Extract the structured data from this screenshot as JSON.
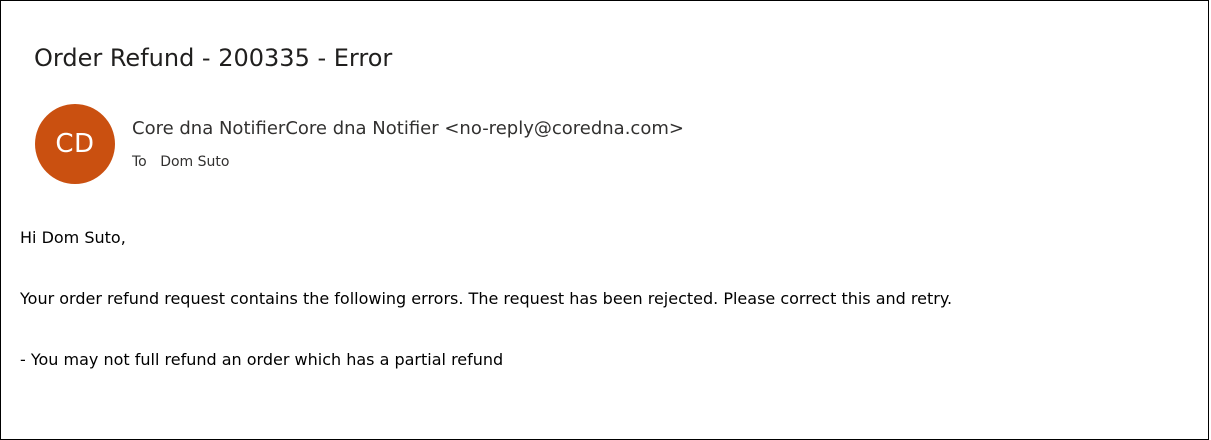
{
  "email": {
    "subject": "Order Refund - 200335 - Error",
    "sender": {
      "initials": "CD",
      "display": "Core dna NotifierCore dna Notifier <no-reply@coredna.com>",
      "avatar_color": "#ca5010"
    },
    "recipients": {
      "label": "To",
      "name": "Dom Suto"
    },
    "body": {
      "greeting": "Hi Dom Suto,",
      "message": "Your order refund request contains the following errors. The request has been rejected. Please correct this and retry.",
      "error": "- You may not full refund an order which has a partial refund"
    }
  }
}
